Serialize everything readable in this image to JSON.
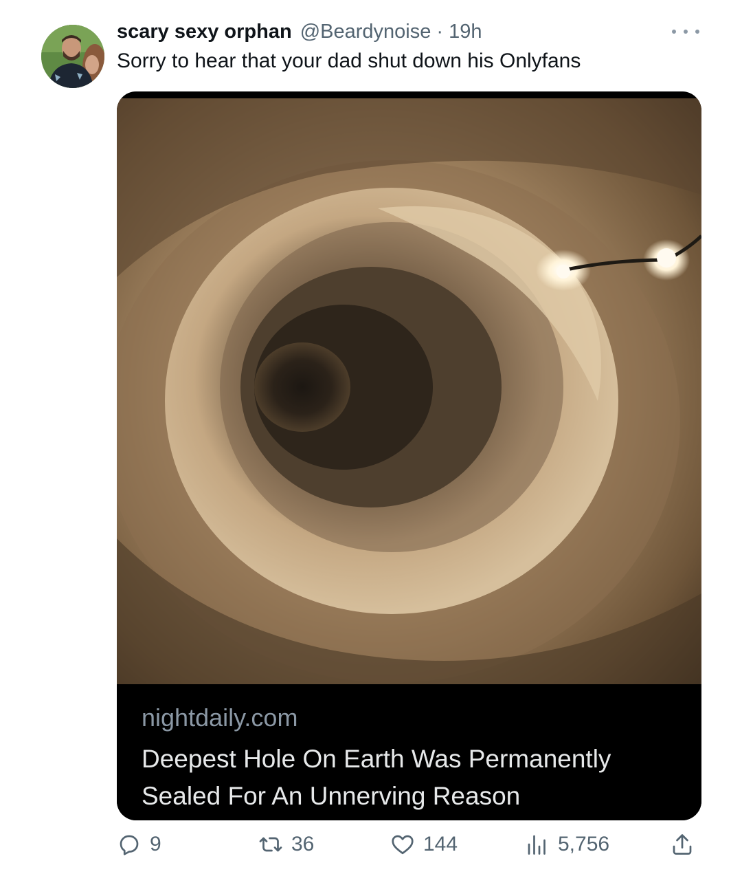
{
  "tweet": {
    "display_name": "scary sexy orphan",
    "handle_time": "@Beardynoise · 19h",
    "text": "Sorry to hear that your dad shut down his Onlyfans"
  },
  "card": {
    "domain": "nightdaily.com",
    "headline": "Deepest Hole On Earth Was Permanently Sealed For An Unnerving Reason"
  },
  "actions": {
    "replies": "9",
    "reposts": "36",
    "likes": "144",
    "views": "5,756"
  },
  "icons": [
    "more-icon",
    "reply-icon",
    "repost-icon",
    "like-icon",
    "views-icon",
    "share-icon"
  ],
  "colors": {
    "text": "#0f1419",
    "secondary": "#536471",
    "card_bg": "#000000"
  }
}
